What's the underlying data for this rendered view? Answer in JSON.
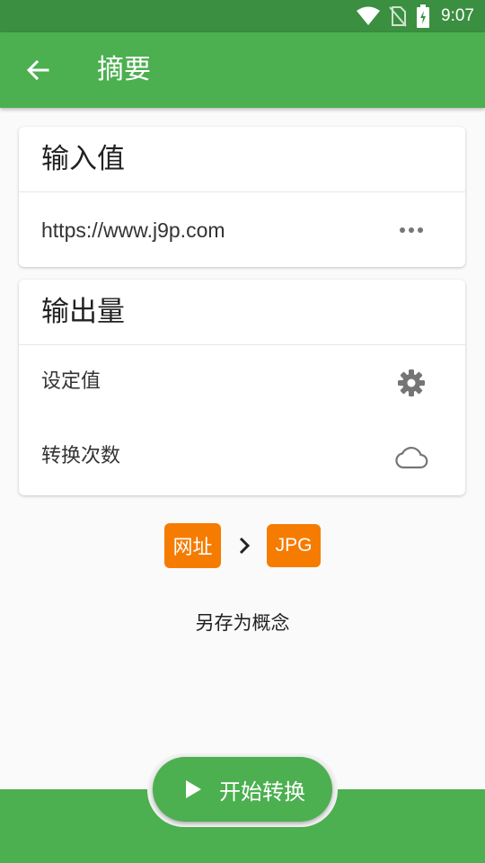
{
  "status_bar": {
    "time": "9:07",
    "icons": [
      "wifi-icon",
      "no-sim-icon",
      "battery-charging-icon"
    ]
  },
  "app_bar": {
    "title": "摘要",
    "back_icon": "arrow-left-icon"
  },
  "input_card": {
    "title": "输入值",
    "value": "https://www.j9p.com",
    "more_icon": "more-horiz-icon"
  },
  "output_card": {
    "title": "输出量",
    "items": [
      {
        "label": "设定值",
        "icon": "gear-icon"
      },
      {
        "label": "转换次数",
        "icon": "cloud-icon"
      }
    ]
  },
  "conversion": {
    "from": "网址",
    "to": "JPG",
    "arrow_icon": "chevron-right-icon"
  },
  "save_as": "另存为概念",
  "action": {
    "label": "开始转换",
    "icon": "play-icon"
  },
  "colors": {
    "primary": "#4caf50",
    "primary_dark": "#3b8f40",
    "accent": "#f57c00"
  }
}
